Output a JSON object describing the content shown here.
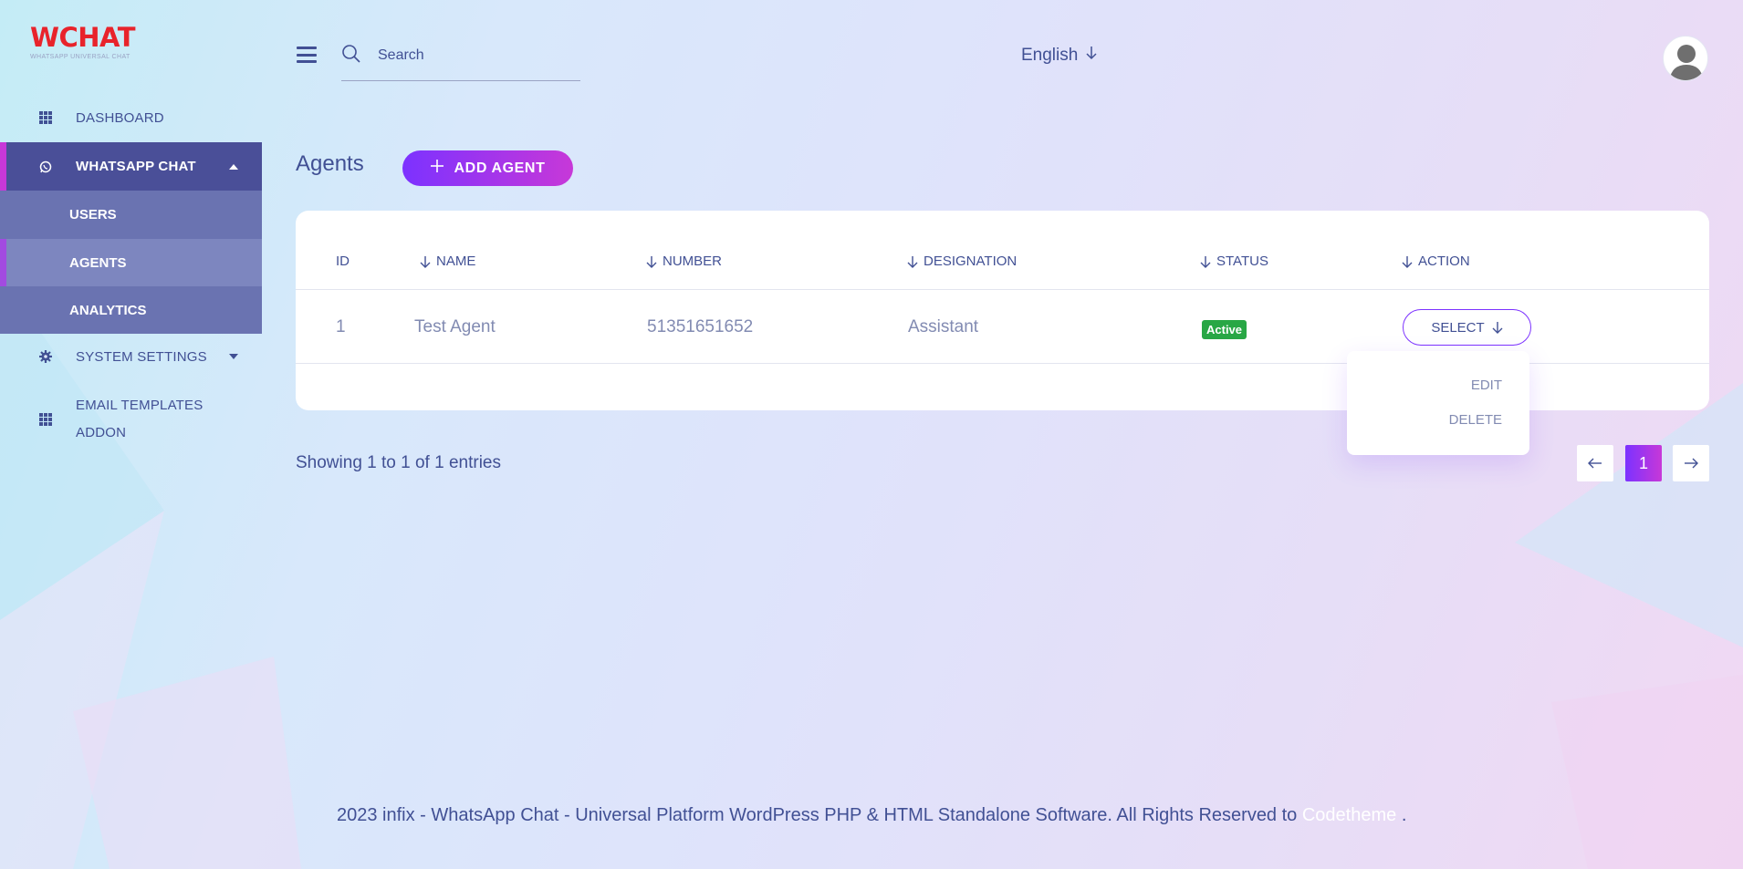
{
  "app": {
    "logo_main": "WCHAT",
    "logo_sub": "WHATSAPP UNIVERSAL CHAT"
  },
  "sidebar": {
    "items": [
      {
        "label": "DASHBOARD",
        "icon": "grid-icon"
      },
      {
        "label": "WHATSAPP CHAT",
        "icon": "whatsapp-icon",
        "expanded": true
      },
      {
        "label": "SYSTEM SETTINGS",
        "icon": "gear-icon"
      },
      {
        "label": "EMAIL TEMPLATES",
        "label2": "ADDON",
        "icon": "grid-icon"
      }
    ],
    "submenu": [
      {
        "label": "USERS"
      },
      {
        "label": "AGENTS",
        "active": true
      },
      {
        "label": "ANALYTICS"
      }
    ]
  },
  "header": {
    "search_placeholder": "Search",
    "language": "English"
  },
  "main": {
    "title": "Agents",
    "add_button": "ADD AGENT",
    "table": {
      "columns": [
        "ID",
        "NAME",
        "NUMBER",
        "DESIGNATION",
        "STATUS",
        "ACTION"
      ],
      "rows": [
        {
          "id": "1",
          "name": "Test Agent",
          "number": "51351651652",
          "designation": "Assistant",
          "status": "Active",
          "action": "SELECT"
        }
      ]
    },
    "action_menu": [
      "EDIT",
      "DELETE"
    ],
    "entries_info": "Showing 1 to 1 of 1 entries",
    "pagination": {
      "current": "1"
    }
  },
  "footer": {
    "text": "2023 infix - WhatsApp Chat - Universal Platform WordPress PHP & HTML Standalone Software. All Rights Reserved to",
    "link": "Codetheme",
    "end": "."
  },
  "colors": {
    "primary": "#415094",
    "accent_start": "#7c32ff",
    "accent_end": "#c738d8",
    "logo_red": "#e8232b",
    "active_nav": "#4a4f98",
    "status_green": "#28a745"
  }
}
